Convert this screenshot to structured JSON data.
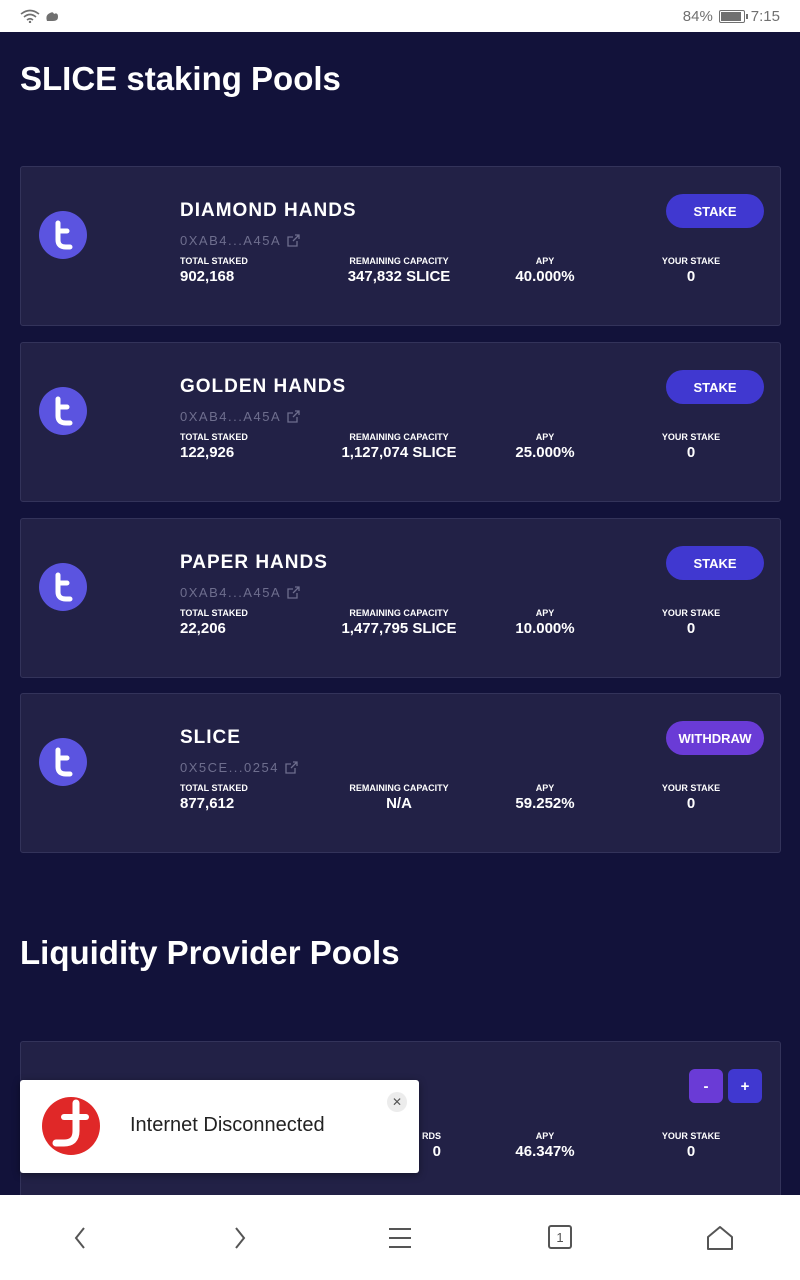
{
  "status_bar": {
    "battery": "84%",
    "time": "7:15",
    "battery_level": 0.84
  },
  "staking": {
    "title": "SLICE staking Pools",
    "pools": [
      {
        "name": "DIAMOND HANDS",
        "address": "0XAB4...A45A",
        "total_staked_label": "TOTAL STAKED",
        "total_staked": "902,168",
        "capacity_label": "REMAINING CAPACITY",
        "capacity": "347,832 SLICE",
        "apy_label": "APY",
        "apy": "40.000%",
        "your_stake_label": "YOUR STAKE",
        "your_stake": "0",
        "action": "STAKE"
      },
      {
        "name": "GOLDEN HANDS",
        "address": "0XAB4...A45A",
        "total_staked_label": "TOTAL STAKED",
        "total_staked": "122,926",
        "capacity_label": "REMAINING CAPACITY",
        "capacity": "1,127,074 SLICE",
        "apy_label": "APY",
        "apy": "25.000%",
        "your_stake_label": "YOUR STAKE",
        "your_stake": "0",
        "action": "STAKE"
      },
      {
        "name": "PAPER HANDS",
        "address": "0XAB4...A45A",
        "total_staked_label": "TOTAL STAKED",
        "total_staked": "22,206",
        "capacity_label": "REMAINING CAPACITY",
        "capacity": "1,477,795 SLICE",
        "apy_label": "APY",
        "apy": "10.000%",
        "your_stake_label": "YOUR STAKE",
        "your_stake": "0",
        "action": "STAKE"
      },
      {
        "name": "SLICE",
        "address": "0X5CE...0254",
        "total_staked_label": "TOTAL STAKED",
        "total_staked": "877,612",
        "capacity_label": "REMAINING CAPACITY",
        "capacity": "N/A",
        "apy_label": "APY",
        "apy": "59.252%",
        "your_stake_label": "YOUR STAKE",
        "your_stake": "0",
        "action": "WITHDRAW"
      }
    ]
  },
  "liquidity": {
    "title": "Liquidity Provider Pools",
    "pool": {
      "rewards_label": "RDS",
      "rewards_value": "0",
      "apy_label": "APY",
      "apy": "46.347%",
      "your_stake_label": "YOUR STAKE",
      "your_stake": "0",
      "minus": "-",
      "plus": "+"
    }
  },
  "toast": {
    "message": "Internet Disconnected",
    "close": "✕"
  },
  "nav": {
    "back_icon": "chevron-left-icon",
    "forward_icon": "chevron-right-icon",
    "menu_icon": "menu-icon",
    "tabs_icon": "tabs-icon",
    "home_icon": "home-icon",
    "tabs_count": "1"
  },
  "colors": {
    "background": "#12123a",
    "card": "#222146",
    "accent": "#4038d0",
    "withdraw": "#6a3bd6",
    "logo": "#5b54e0"
  }
}
